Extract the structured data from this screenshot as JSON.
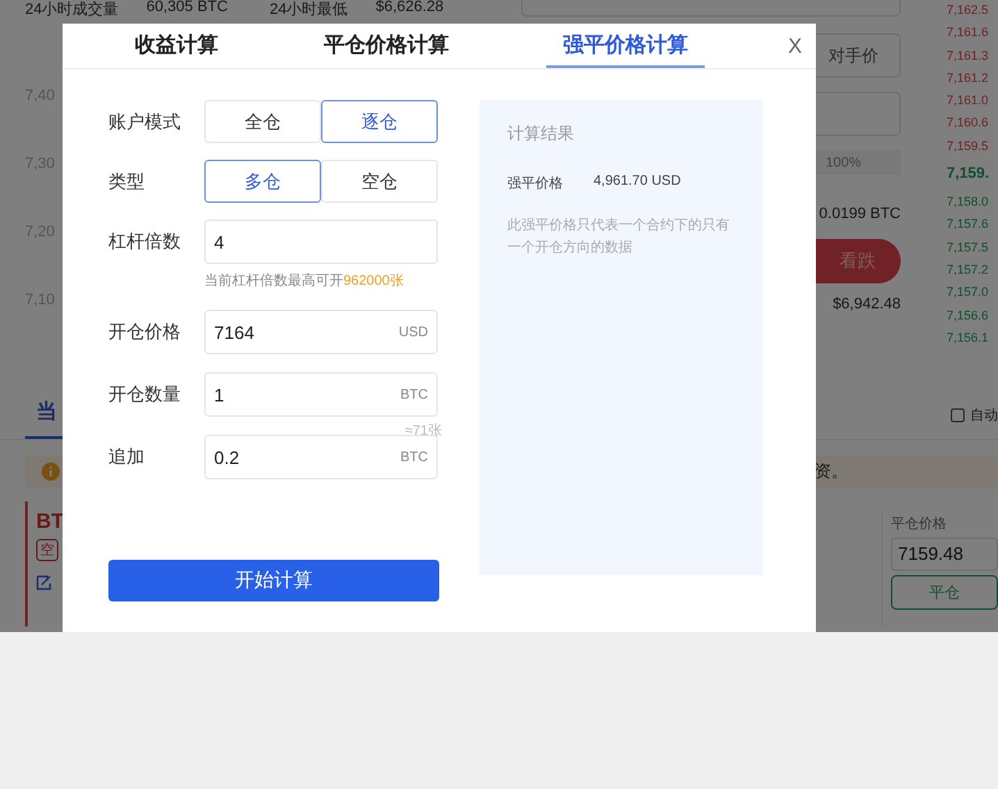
{
  "background": {
    "stats": [
      {
        "label": "24小时成交量",
        "value": "60,305 BTC"
      },
      {
        "label": "24小时最低",
        "value": "$6,626.28"
      }
    ],
    "axis_labels": [
      "7,40",
      "7,30",
      "7,20",
      "7,10"
    ],
    "order_panel": {
      "price_button": "对手价",
      "slider_label": "100%",
      "available": "0.0199 BTC",
      "sell_button": "看跌",
      "balance": "$6,942.48"
    },
    "order_book": {
      "asks": [
        "7,162.5",
        "7,161.6",
        "7,161.3",
        "7,161.2",
        "7,161.0",
        "7,160.6",
        "7,159.5"
      ],
      "mid": "7,159.",
      "bids": [
        "7,158.0",
        "7,157.6",
        "7,157.5",
        "7,157.2",
        "7,157.0",
        "7,156.6",
        "7,156.1"
      ]
    },
    "positions_tab": "当",
    "auto_checkbox": {
      "label": "自动",
      "checked": false
    },
    "notice_text": "资。",
    "position": {
      "symbol": "BT",
      "side_tag": "空",
      "close_price_label": "平仓价格",
      "close_price": "7159.48",
      "close_button": "平仓"
    }
  },
  "dialog": {
    "tabs": [
      {
        "label": "收益计算",
        "selected": false
      },
      {
        "label": "平仓价格计算",
        "selected": false
      },
      {
        "label": "强平价格计算",
        "selected": true
      }
    ],
    "close": "X",
    "rows": [
      {
        "kind": "segmented",
        "label": "账户模式",
        "options": [
          {
            "label": "全仓",
            "selected": false
          },
          {
            "label": "逐仓",
            "selected": true
          }
        ]
      },
      {
        "kind": "segmented",
        "label": "类型",
        "options": [
          {
            "label": "多仓",
            "selected": true
          },
          {
            "label": "空仓",
            "selected": false
          }
        ]
      },
      {
        "kind": "input",
        "label": "杠杆倍数",
        "value": "4",
        "hint": "当前杠杆倍数最高可开",
        "hint_highlight": "962000张"
      },
      {
        "kind": "input",
        "label": "开仓价格",
        "value": "7164",
        "unit": "USD"
      },
      {
        "kind": "input",
        "label": "开仓数量",
        "value": "1",
        "unit": "BTC",
        "note": "≈71张"
      },
      {
        "kind": "input",
        "label": "追加",
        "value": "0.2",
        "unit": "BTC"
      }
    ],
    "submit": "开始计算",
    "result": {
      "title": "计算结果",
      "label": "强平价格",
      "value": "4,961.70 USD",
      "note": "此强平价格只代表一个合约下的只有一个开仓方向的数据"
    }
  }
}
